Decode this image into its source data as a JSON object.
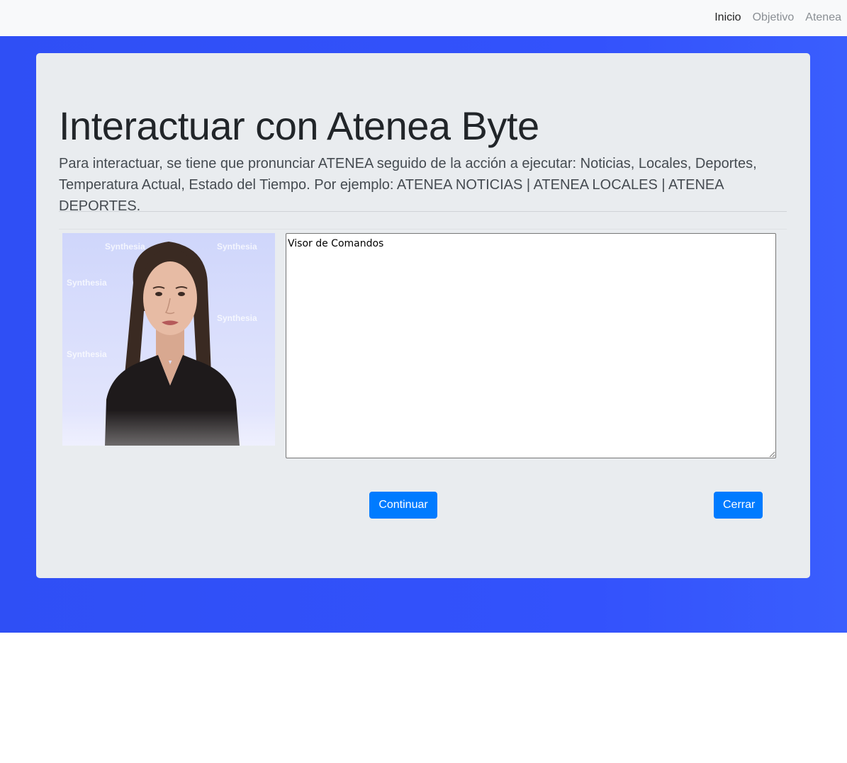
{
  "nav": {
    "items": [
      {
        "label": "Inicio",
        "active": true
      },
      {
        "label": "Objetivo",
        "active": false
      },
      {
        "label": "Atenea",
        "active": false
      }
    ]
  },
  "main": {
    "title": "Interactuar con Atenea Byte",
    "lead": "Para interactuar, se tiene que pronunciar ATENEA seguido de la acción a ejecutar: Noticias, Locales, Deportes, Temperatura Actual, Estado del Tiempo. Por ejemplo: ATENEA NOTICIAS | ATENEA LOCALES | ATENEA DEPORTES.",
    "avatar_watermark": "Synthesia",
    "visor_value": "Visor de Comandos",
    "continue_label": "Continuar",
    "close_label": "Cerrar"
  },
  "colors": {
    "hero_bg": "#3352fc",
    "panel_bg": "#e9ecef",
    "button": "#007bff"
  }
}
